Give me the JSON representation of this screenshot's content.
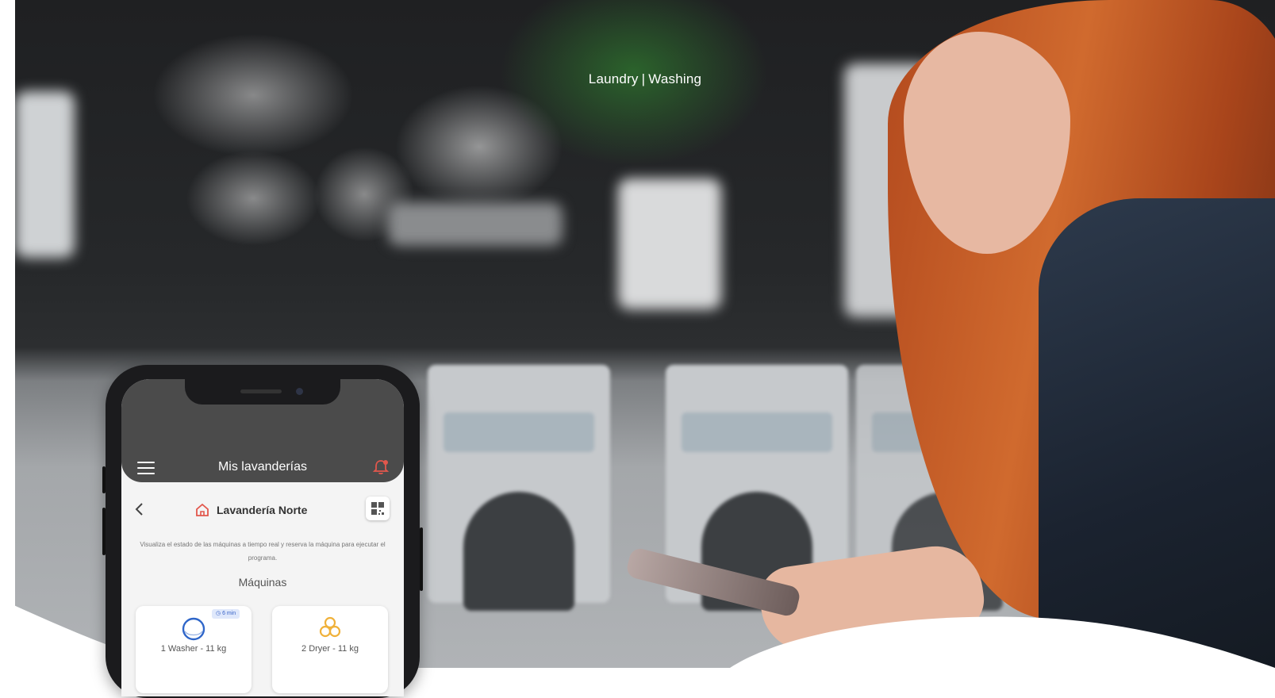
{
  "header": {
    "category": "Laundry",
    "separator": "|",
    "subcategory": "Washing"
  },
  "phone": {
    "topbar_title": "Mis lavanderías",
    "store_name": "Lavandería Norte",
    "description": "Visualiza el estado de las máquinas a tiempo real y reserva la máquina para ejecutar el programa.",
    "section_title": "Máquinas",
    "machines": [
      {
        "label": "1 Washer - 11 kg",
        "badge": "6 min",
        "icon": "washer-icon"
      },
      {
        "label": "2 Dryer - 11 kg",
        "icon": "dryer-icon"
      }
    ]
  },
  "colors": {
    "accent": "#e2574c",
    "topbar": "#4b4b4b",
    "washer_blue": "#2f66c9",
    "dryer_amber": "#f0b13a"
  }
}
